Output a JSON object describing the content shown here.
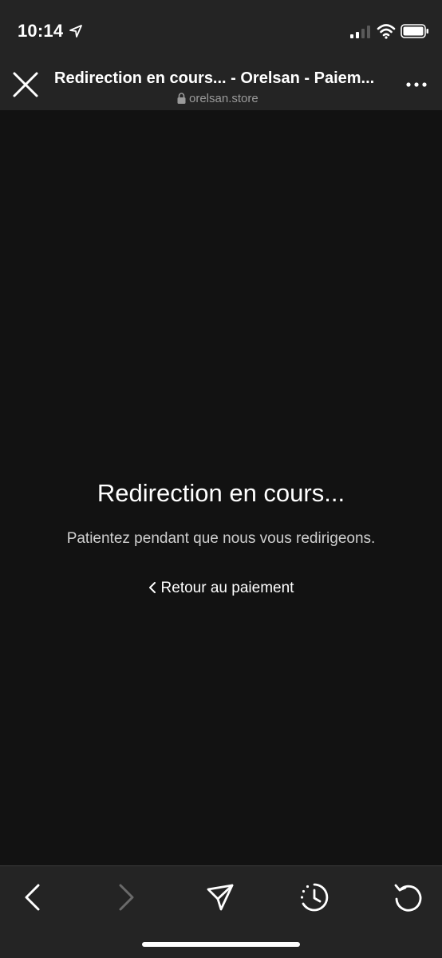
{
  "status_bar": {
    "time": "10:14",
    "icons": [
      "location-arrow-icon",
      "signal-icon",
      "wifi-icon",
      "battery-icon"
    ]
  },
  "browser": {
    "title": "Redirection en cours... - Orelsan - Paiem...",
    "url": "orelsan.store",
    "close_icon": "close-icon",
    "more_icon": "more-icon"
  },
  "page": {
    "title": "Redirection en cours...",
    "subtitle": "Patientez pendant que nous vous redirigeons.",
    "back_link": "Retour au paiement"
  },
  "toolbar": {
    "items": [
      "back-icon",
      "forward-icon",
      "share-icon",
      "history-icon",
      "reload-icon"
    ]
  },
  "colors": {
    "background": "#121212",
    "chrome": "#242424",
    "text": "#ffffff",
    "muted_text": "#9a9a9a"
  }
}
